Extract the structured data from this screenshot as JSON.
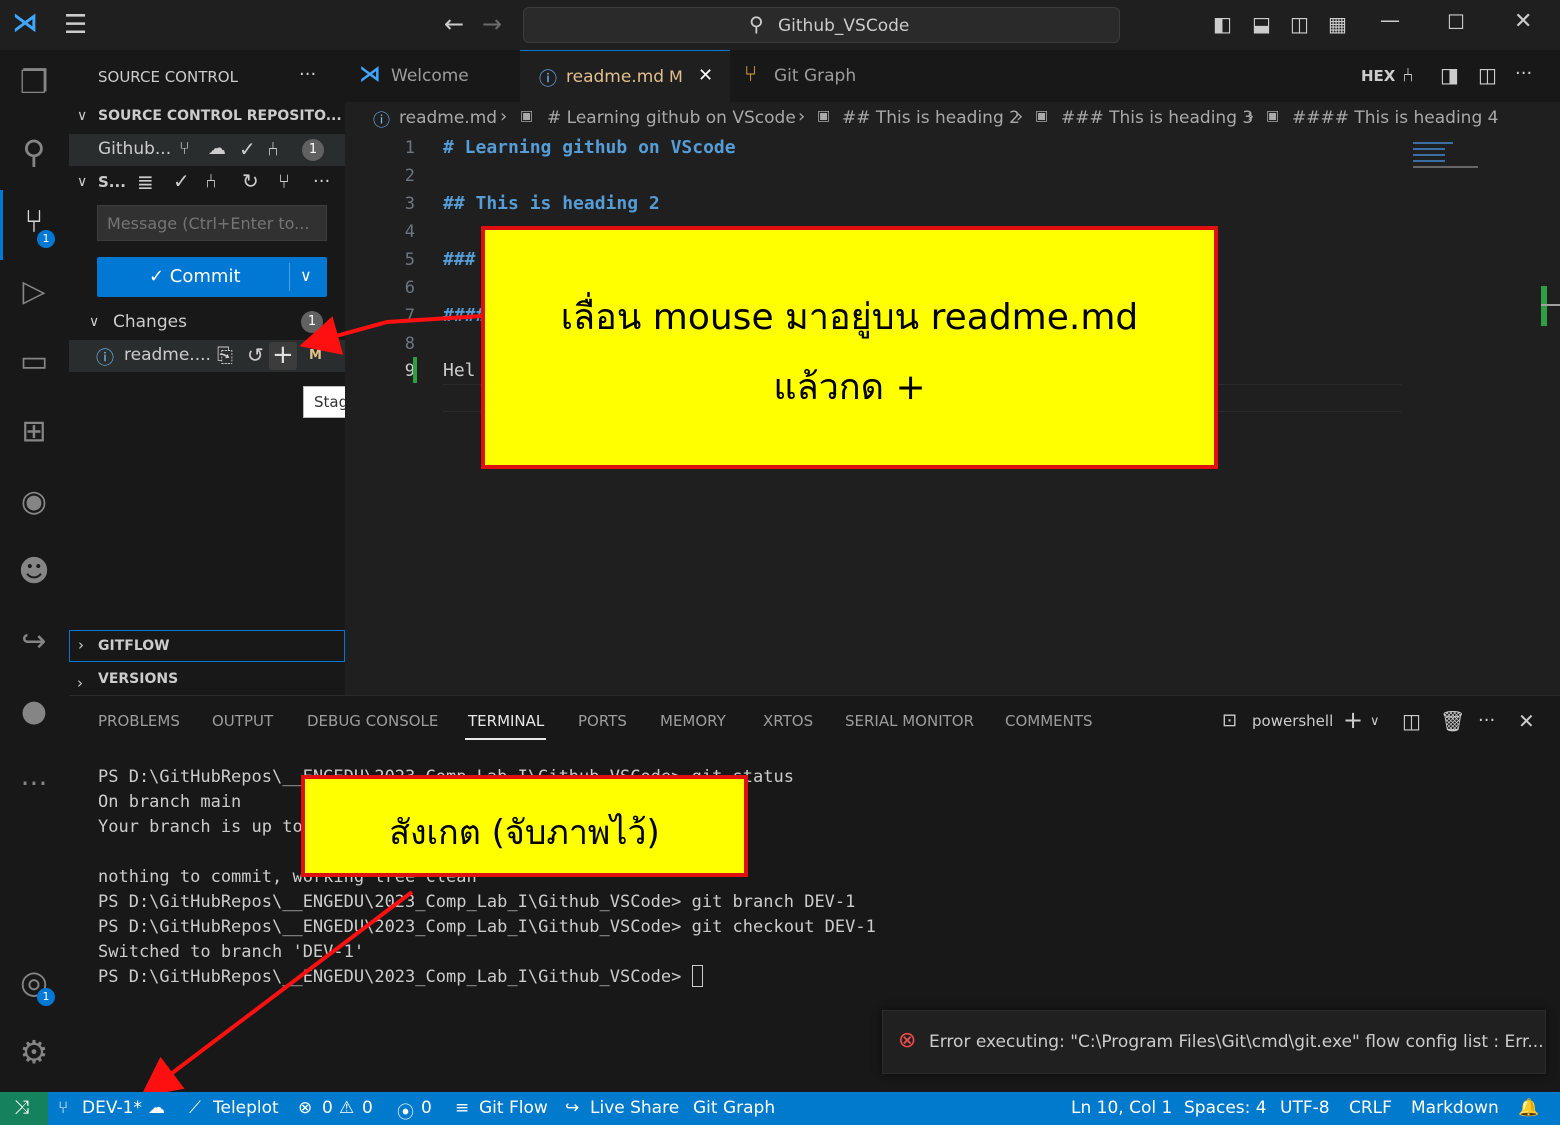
{
  "window": {
    "search_title": "Github_VSCode"
  },
  "sidebar": {
    "title": "SOURCE CONTROL",
    "more": "···",
    "repos_header": "SOURCE CONTROL REPOSITO...",
    "repo_name": "Github...",
    "repo_badge": "1",
    "sc_short": "S...",
    "message_placeholder": "Message (Ctrl+Enter to...",
    "commit_label": "✓ Commit",
    "changes_label": "Changes",
    "changes_badge": "1",
    "file_name": "readme....",
    "file_status": "M",
    "tooltip": "Stage Changes",
    "gitflow": "GITFLOW",
    "versions": "VERSIONS",
    "scm_badge": "1",
    "accounts_badge": "1"
  },
  "tabs": [
    {
      "label": "Welcome"
    },
    {
      "label": "readme.md",
      "status": "M"
    },
    {
      "label": "Git Graph"
    }
  ],
  "editor_actions": {
    "hex": "HEX"
  },
  "breadcrumb": [
    "readme.md",
    "# Learning github on VScode",
    "## This is heading 2",
    "### This is heading 3",
    "#### This is heading 4"
  ],
  "editor": {
    "line_numbers": [
      "1",
      "2",
      "3",
      "4",
      "5",
      "6",
      "7",
      "8",
      "9"
    ],
    "lines": [
      "# Learning github on VScode",
      "",
      "## This is heading 2",
      "",
      "###",
      "",
      "####",
      "",
      "Hel"
    ]
  },
  "panel": {
    "tabs": [
      "PROBLEMS",
      "OUTPUT",
      "DEBUG CONSOLE",
      "TERMINAL",
      "PORTS",
      "MEMORY",
      "XRTOS",
      "SERIAL MONITOR",
      "COMMENTS"
    ],
    "shell": "powershell",
    "terminal_lines": [
      "PS D:\\GitHubRepos\\__ENGEDU\\2023_Comp_Lab_I\\Github_VSCode> git status",
      "On branch main",
      "Your branch is up to date with 'origin/main'.",
      "",
      "nothing to commit, working tree clean",
      "PS D:\\GitHubRepos\\__ENGEDU\\2023_Comp_Lab_I\\Github_VSCode> git branch DEV-1",
      "PS D:\\GitHubRepos\\__ENGEDU\\2023_Comp_Lab_I\\Github_VSCode> git checkout DEV-1",
      "Switched to branch 'DEV-1'",
      "PS D:\\GitHubRepos\\__ENGEDU\\2023_Comp_Lab_I\\Github_VSCode> "
    ]
  },
  "notification": {
    "text": "Error executing: \"C:\\Program Files\\Git\\cmd\\git.exe\" flow config list : Err..."
  },
  "statusbar": {
    "branch": "DEV-1*",
    "teleplot": "Teleplot",
    "errors": "0",
    "warnings": "0",
    "ports": "0",
    "gitflow": "Git Flow",
    "liveshare": "Live Share",
    "gitgraph": "Git Graph",
    "position": "Ln 10, Col 1",
    "spaces": "Spaces: 4",
    "encoding": "UTF-8",
    "eol": "CRLF",
    "language": "Markdown"
  },
  "callouts": {
    "main_line1": "เลื่อน mouse มาอยู่บน readme.md",
    "main_line2": "แล้วกด +",
    "observe": "สังเกต (จับภาพไว้)"
  },
  "colors": {
    "accent": "#007acc",
    "callout_fill": "#ffff00",
    "callout_border": "#e01010",
    "commit_button": "#0078d4"
  }
}
